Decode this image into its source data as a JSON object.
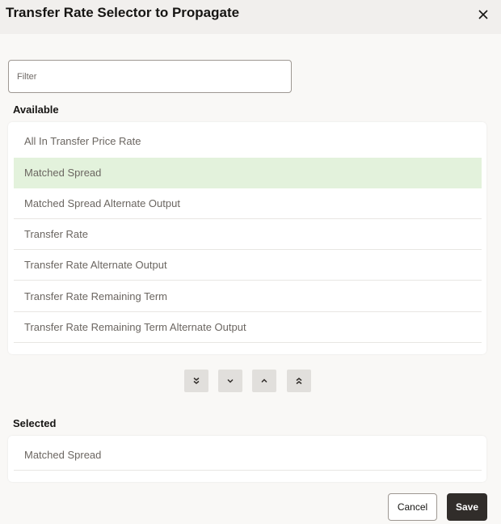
{
  "dialog": {
    "title": "Transfer Rate Selector to Propagate",
    "close_icon": "close-icon"
  },
  "filter": {
    "placeholder": "Filter",
    "value": ""
  },
  "available": {
    "label": "Available",
    "items": [
      {
        "label": "All In Transfer Price Rate",
        "selected": false
      },
      {
        "label": "Matched Spread",
        "selected": true
      },
      {
        "label": "Matched Spread Alternate Output",
        "selected": false
      },
      {
        "label": "Transfer Rate",
        "selected": false
      },
      {
        "label": "Transfer Rate Alternate Output",
        "selected": false
      },
      {
        "label": "Transfer Rate Remaining Term",
        "selected": false
      },
      {
        "label": "Transfer Rate Remaining Term Alternate Output",
        "selected": false
      }
    ]
  },
  "move_controls": [
    {
      "name": "move-all-down",
      "icon": "double-chevron-down-icon"
    },
    {
      "name": "move-down",
      "icon": "chevron-down-icon"
    },
    {
      "name": "move-up",
      "icon": "chevron-up-icon"
    },
    {
      "name": "move-all-up",
      "icon": "double-chevron-up-icon"
    }
  ],
  "selected": {
    "label": "Selected",
    "items": [
      {
        "label": "Matched Spread"
      }
    ]
  },
  "footer": {
    "cancel_label": "Cancel",
    "save_label": "Save"
  },
  "colors": {
    "selected_row": "#e3f2dc",
    "save_button": "#312d2a",
    "header_bg": "#f1efed"
  }
}
